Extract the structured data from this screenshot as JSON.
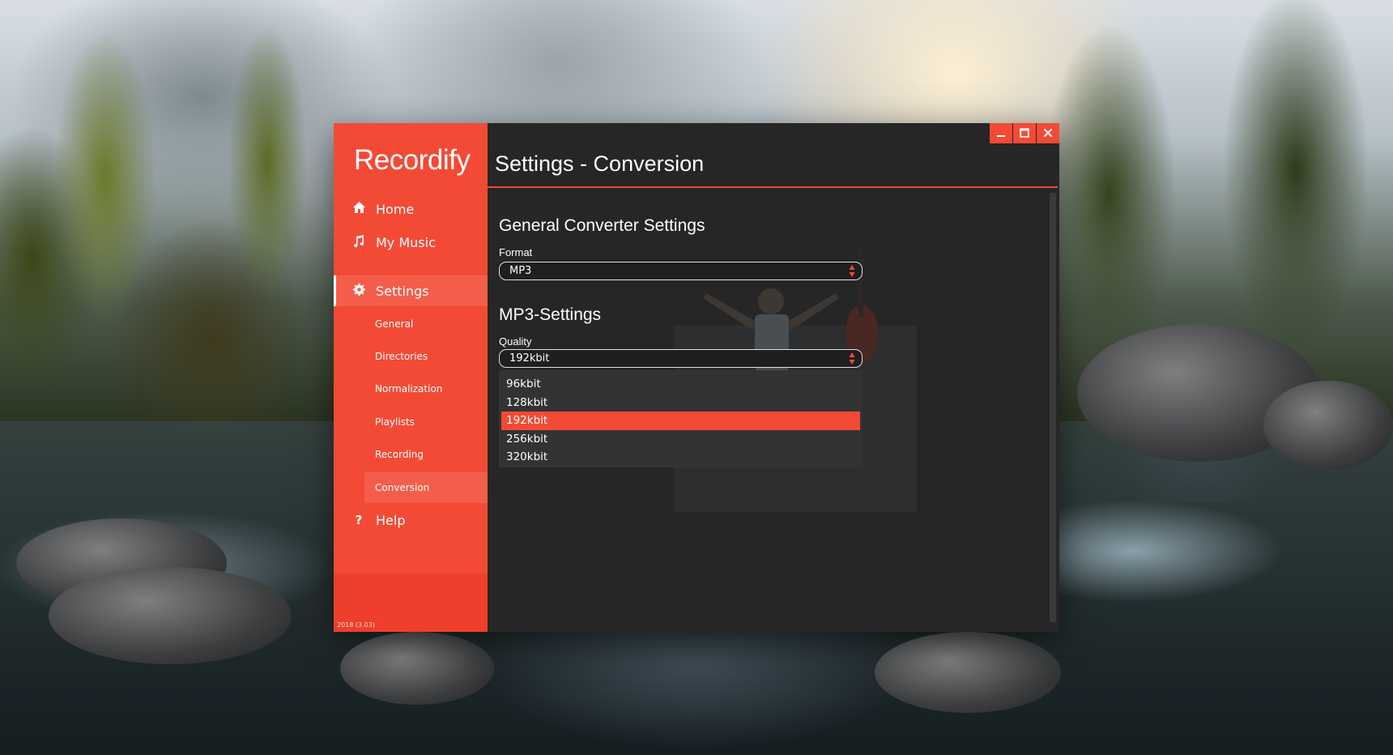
{
  "app": {
    "logo": "Recordify",
    "version": "2018 (3.03)",
    "accent_color": "#f34a36"
  },
  "sidebar": {
    "nav": [
      {
        "label": "Home",
        "icon": "home-icon"
      },
      {
        "label": "My Music",
        "icon": "music-note-icon"
      },
      {
        "label": "Settings",
        "icon": "gear-icon",
        "active": true
      }
    ],
    "settings_sub": [
      {
        "label": "General"
      },
      {
        "label": "Directories"
      },
      {
        "label": "Normalization"
      },
      {
        "label": "Playlists"
      },
      {
        "label": "Recording"
      },
      {
        "label": "Conversion",
        "active": true
      }
    ],
    "help": {
      "label": "Help",
      "icon": "question-icon"
    }
  },
  "window_controls": [
    "minimize-icon",
    "maximize-icon",
    "close-icon"
  ],
  "main": {
    "title": "Settings - Conversion",
    "general_section": {
      "title": "General Converter Settings",
      "format_label": "Format",
      "format_value": "MP3"
    },
    "mp3_section": {
      "title": "MP3-Settings",
      "quality_label": "Quality",
      "quality_value": "192kbit",
      "quality_options": [
        "96kbit",
        "128kbit",
        "192kbit",
        "256kbit",
        "320kbit"
      ],
      "quality_selected": "192kbit"
    }
  }
}
